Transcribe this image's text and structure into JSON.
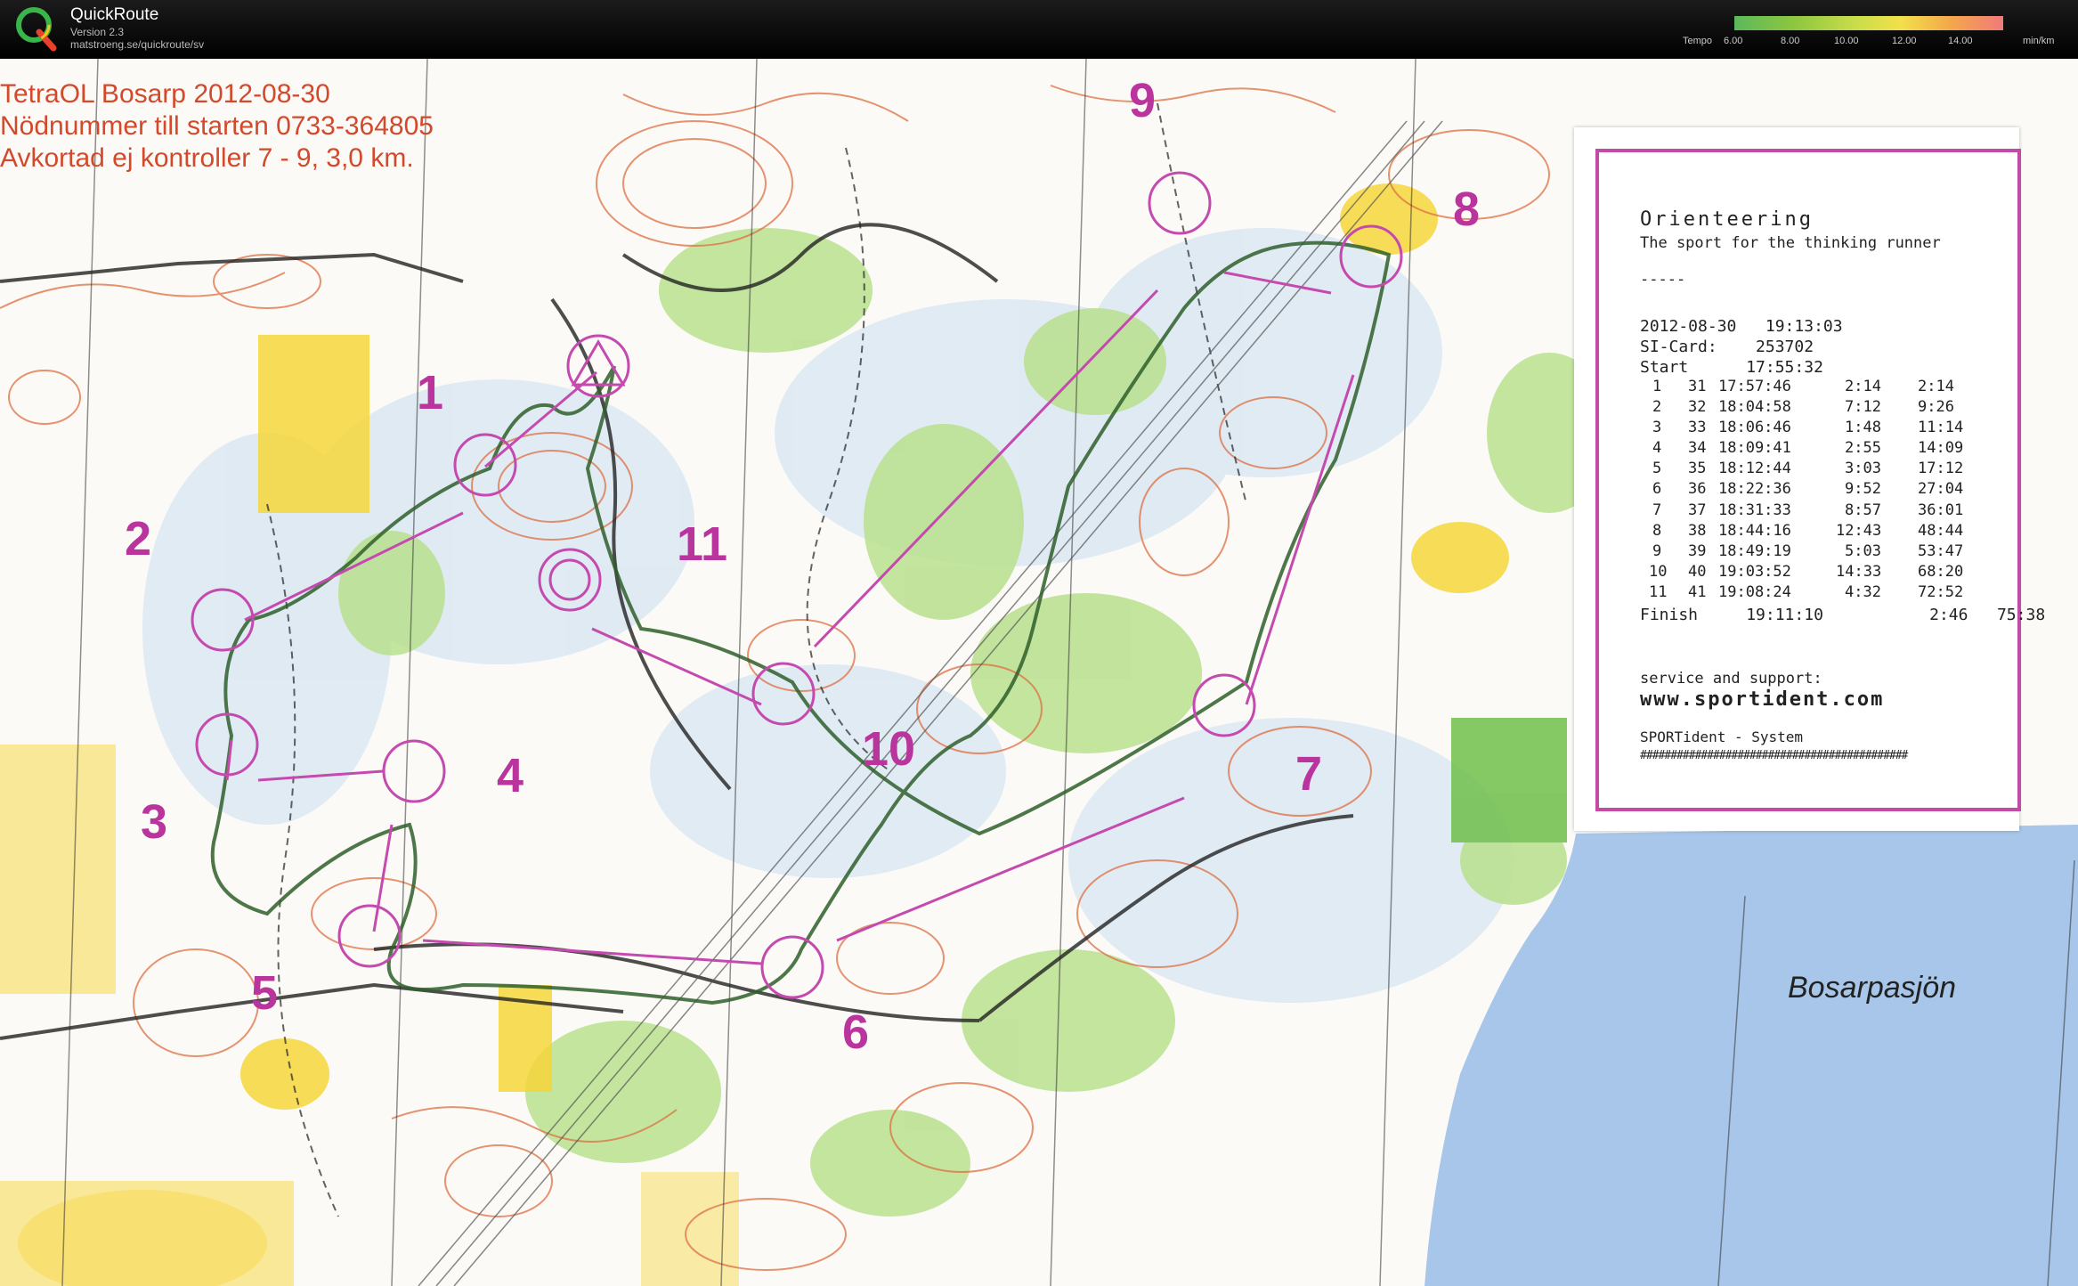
{
  "app": {
    "title": "QuickRoute",
    "version": "Version 2.3",
    "url": "matstroeng.se/quickroute/sv"
  },
  "tempo_legend": {
    "label": "Tempo",
    "ticks": [
      "6.00",
      "8.00",
      "10.00",
      "12.00",
      "14.00"
    ],
    "unit": "min/km",
    "colors": [
      "#5cb85c",
      "#8cc63f",
      "#c9dd4a",
      "#f2e04a",
      "#f4a94a",
      "#f07a7a"
    ]
  },
  "map": {
    "event_title": "TetraOL Bosarp 2012-08-30",
    "emergency": "Nödnummer till starten 0733-364805",
    "shortened": "Avkortad ej kontroller 7 - 9, 3,0 km.",
    "lake_name": "Bosarpasjön",
    "controls": [
      "1",
      "2",
      "3",
      "4",
      "5",
      "6",
      "7",
      "8",
      "9",
      "10",
      "11"
    ],
    "colors": {
      "course": "#c54aaf",
      "contour": "#d9663a",
      "vegetation_green": "#b8e08a",
      "open_yellow": "#f7d73a",
      "water": "#a9c8ea",
      "route": "#2f5f2a"
    }
  },
  "receipt": {
    "title": "Orienteering",
    "subtitle": "The sport for the thinking runner",
    "dashes": "-----",
    "datetime": "2012-08-30   19:13:03",
    "si_card": "SI-Card:    253702",
    "start": "Start      17:55:32",
    "splits": [
      {
        "n": "1",
        "code": "31",
        "time": "17:57:46",
        "leg": "2:14",
        "total": "2:14"
      },
      {
        "n": "2",
        "code": "32",
        "time": "18:04:58",
        "leg": "7:12",
        "total": "9:26"
      },
      {
        "n": "3",
        "code": "33",
        "time": "18:06:46",
        "leg": "1:48",
        "total": "11:14"
      },
      {
        "n": "4",
        "code": "34",
        "time": "18:09:41",
        "leg": "2:55",
        "total": "14:09"
      },
      {
        "n": "5",
        "code": "35",
        "time": "18:12:44",
        "leg": "3:03",
        "total": "17:12"
      },
      {
        "n": "6",
        "code": "36",
        "time": "18:22:36",
        "leg": "9:52",
        "total": "27:04"
      },
      {
        "n": "7",
        "code": "37",
        "time": "18:31:33",
        "leg": "8:57",
        "total": "36:01"
      },
      {
        "n": "8",
        "code": "38",
        "time": "18:44:16",
        "leg": "12:43",
        "total": "48:44"
      },
      {
        "n": "9",
        "code": "39",
        "time": "18:49:19",
        "leg": "5:03",
        "total": "53:47"
      },
      {
        "n": "10",
        "code": "40",
        "time": "19:03:52",
        "leg": "14:33",
        "total": "68:20"
      },
      {
        "n": "11",
        "code": "41",
        "time": "19:08:24",
        "leg": "4:32",
        "total": "72:52"
      }
    ],
    "finish": "Finish     19:11:10           2:46   75:38",
    "service": "service and support:",
    "website": "www.sportident.com",
    "system": "SPORTident - System",
    "hash": "############################################"
  }
}
